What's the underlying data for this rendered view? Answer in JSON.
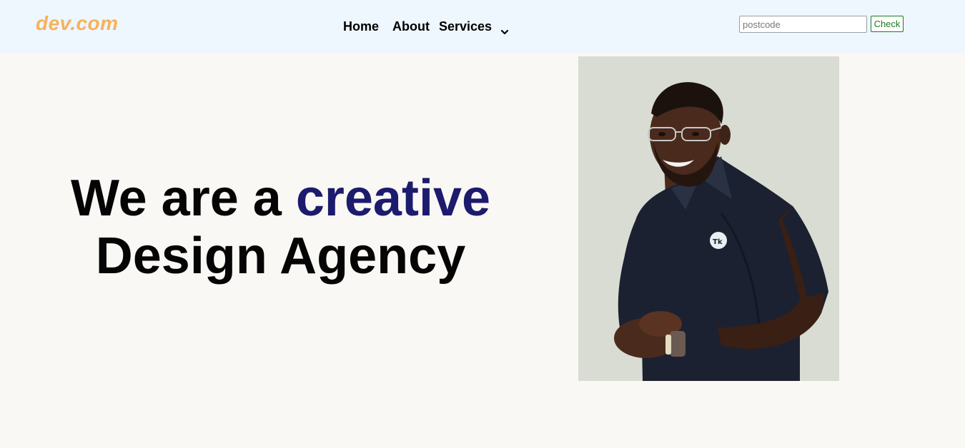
{
  "header": {
    "logo_text": "dev.com",
    "logo_color": "#f6b25b",
    "nav": {
      "home": "Home",
      "about": "About",
      "services": "Services"
    },
    "postcode_placeholder": "postcode",
    "postcode_value": "",
    "check_label": "Check"
  },
  "hero": {
    "title_part1": "We are a",
    "title_accent": "creative",
    "title_part2": "Design Agency",
    "accent_color": "#1c1b6e"
  },
  "photo": {
    "icon": "person-portrait-icon",
    "shirt_badge_text": "Tk"
  }
}
